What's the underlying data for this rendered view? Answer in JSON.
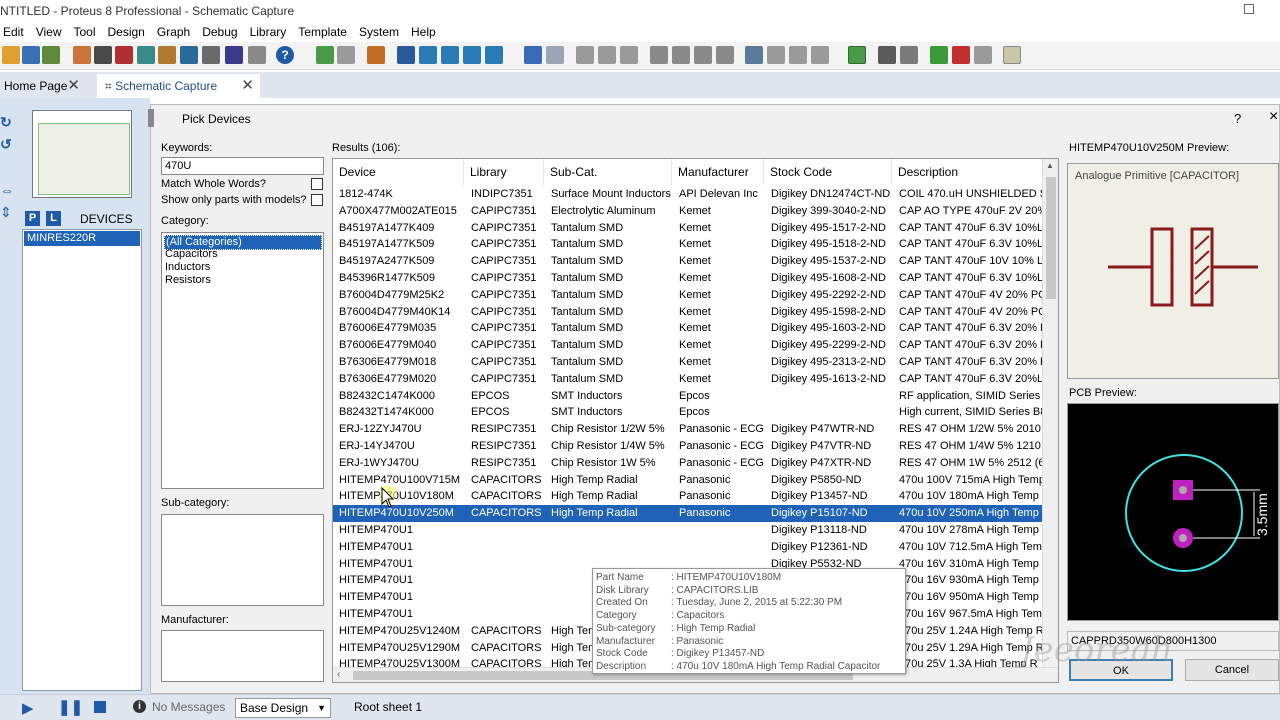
{
  "window": {
    "title": "NTITLED - Proteus 8 Professional - Schematic Capture"
  },
  "menu": [
    "Edit",
    "View",
    "Tool",
    "Design",
    "Graph",
    "Debug",
    "Library",
    "Template",
    "System",
    "Help"
  ],
  "tabs": [
    {
      "label": "Home Page"
    },
    {
      "label": "Schematic Capture"
    }
  ],
  "left_panel": {
    "mode_p": "P",
    "mode_l": "L",
    "devices_label": "DEVICES",
    "devices": [
      "MINRES220R"
    ]
  },
  "dialog": {
    "title": "Pick Devices",
    "help": "?",
    "close": "×",
    "keywords_label": "Keywords:",
    "keywords_value": "470U",
    "match_whole_words": "Match Whole Words?",
    "show_only_models": "Show only parts with models?",
    "category_label": "Category:",
    "categories": [
      "(All Categories)",
      "Capacitors",
      "Inductors",
      "Resistors"
    ],
    "subcategory_label": "Sub-category:",
    "manufacturer_label": "Manufacturer:",
    "results_label": "Results (106):",
    "columns": [
      "Device",
      "Library",
      "Sub-Cat.",
      "Manufacturer",
      "Stock Code",
      "Description"
    ],
    "rows": [
      [
        "1812-474K",
        "INDIPC7351",
        "Surface Mount Inductors",
        "API Delevan Inc",
        "Digikey DN12474CT-ND",
        "COIL 470.uH UNSHIELDED S"
      ],
      [
        "A700X477M002ATE015",
        "CAPIPC7351",
        "Electrolytic Aluminum",
        "Kemet",
        "Digikey 399-3040-2-ND",
        "CAP AO TYPE 470uF 2V 20%"
      ],
      [
        "B45197A1477K409",
        "CAPIPC7351",
        "Tantalum SMD",
        "Kemet",
        "Digikey 495-1517-2-ND",
        "CAP TANT 470uF 6.3V 10%LO"
      ],
      [
        "B45197A1477K509",
        "CAPIPC7351",
        "Tantalum SMD",
        "Kemet",
        "Digikey 495-1518-2-ND",
        "CAP TANT 470uF 6.3V 10%LO"
      ],
      [
        "B45197A2477K509",
        "CAPIPC7351",
        "Tantalum SMD",
        "Kemet",
        "Digikey 495-1537-2-ND",
        "CAP TANT 470uF 10V 10% LO"
      ],
      [
        "B45396R1477K509",
        "CAPIPC7351",
        "Tantalum SMD",
        "Kemet",
        "Digikey 495-1608-2-ND",
        "CAP TANT 470uF 6.3V 10%LO"
      ],
      [
        "B76004D4779M25K2",
        "CAPIPC7351",
        "Tantalum SMD",
        "Kemet",
        "Digikey 495-2292-2-ND",
        "CAP TANT 470uF 4V 20% PO"
      ],
      [
        "B76004D4779M40K14",
        "CAPIPC7351",
        "Tantalum SMD",
        "Kemet",
        "Digikey 495-1598-2-ND",
        "CAP TANT 470uF 4V 20% PO"
      ],
      [
        "B76006E4779M035",
        "CAPIPC7351",
        "Tantalum SMD",
        "Kemet",
        "Digikey 495-1603-2-ND",
        "CAP TANT 470uF 6.3V 20% P"
      ],
      [
        "B76006E4779M040",
        "CAPIPC7351",
        "Tantalum SMD",
        "Kemet",
        "Digikey 495-2299-2-ND",
        "CAP TANT 470uF 6.3V 20% P"
      ],
      [
        "B76306E4779M018",
        "CAPIPC7351",
        "Tantalum SMD",
        "Kemet",
        "Digikey 495-2313-2-ND",
        "CAP TANT 470uF 6.3V 20% P"
      ],
      [
        "B76306E4779M020",
        "CAPIPC7351",
        "Tantalum SMD",
        "Kemet",
        "Digikey 495-1613-2-ND",
        "CAP TANT 470uF 6.3V 20%LO"
      ],
      [
        "B82432C1474K000",
        "EPCOS",
        "SMT Inductors",
        "Epcos",
        "",
        "RF application, SIMID Series E"
      ],
      [
        "B82432T1474K000",
        "EPCOS",
        "SMT Inductors",
        "Epcos",
        "",
        "High current, SIMID Series B8"
      ],
      [
        "ERJ-12ZYJ470U",
        "RESIPC7351",
        "Chip Resistor 1/2W 5%",
        "Panasonic - ECG",
        "Digikey P47WTR-ND",
        "RES 47 OHM 1/2W 5% 2010"
      ],
      [
        "ERJ-14YJ470U",
        "RESIPC7351",
        "Chip Resistor 1/4W 5%",
        "Panasonic - ECG",
        "Digikey P47VTR-ND",
        "RES 47 OHM 1/4W 5% 1210"
      ],
      [
        "ERJ-1WYJ470U",
        "RESIPC7351",
        "Chip Resistor 1W 5%",
        "Panasonic - ECG",
        "Digikey P47XTR-ND",
        "RES 47 OHM 1W 5% 2512 (64"
      ],
      [
        "HITEMP470U100V715M",
        "CAPACITORS",
        "High Temp Radial",
        "Panasonic",
        "Digikey P5850-ND",
        "470u 100V 715mA High Temp"
      ],
      [
        "HITEMP470U10V180M",
        "CAPACITORS",
        "High Temp Radial",
        "Panasonic",
        "Digikey P13457-ND",
        "470u 10V 180mA High Temp F"
      ],
      [
        "HITEMP470U10V250M",
        "CAPACITORS",
        "High Temp Radial",
        "Panasonic",
        "Digikey P15107-ND",
        "470u 10V 250mA High Temp F"
      ],
      [
        "HITEMP470U1",
        "",
        "",
        "",
        "Digikey P13118-ND",
        "470u 10V 278mA High Temp F"
      ],
      [
        "HITEMP470U1",
        "",
        "",
        "",
        "Digikey P12361-ND",
        "470u 10V 712.5mA High Temp"
      ],
      [
        "HITEMP470U1",
        "",
        "",
        "",
        "Digikey P5532-ND",
        "470u 16V 310mA High Temp F"
      ],
      [
        "HITEMP470U1",
        "",
        "",
        "",
        "Digikey P12376-ND",
        "470u 16V 930mA High Temp F"
      ],
      [
        "HITEMP470U1",
        "",
        "",
        "",
        "Digikey P14394-ND",
        "470u 16V 950mA High Temp F"
      ],
      [
        "HITEMP470U1",
        "",
        "",
        "",
        "Digikey P12375-ND",
        "470u 16V 967.5mA High Temp"
      ],
      [
        "HITEMP470U25V1240M",
        "CAPACITORS",
        "High Temp Radial",
        "Panasonic",
        "Digikey P14417-ND",
        "470u 25V 1.24A High Temp R"
      ],
      [
        "HITEMP470U25V1290M",
        "CAPACITORS",
        "High Temp Radial",
        "Panasonic",
        "Digikey P14419-ND",
        "470u 25V 1.29A High Temp R"
      ],
      [
        "HITEMP470U25V1300M",
        "CAPACITORS",
        "High Temp Radial",
        "Panasonic",
        "Digikey P12388-ND",
        "470u 25V 1.3A High Temp R"
      ]
    ],
    "tooltip": [
      [
        "Part Name",
        ": HITEMP470U10V180M"
      ],
      [
        "Disk Library",
        ": CAPACITORS.LIB"
      ],
      [
        "Created On",
        ": Tuesday, June 2, 2015 at 5:22:30 PM"
      ],
      [
        "Category",
        ": Capacitors"
      ],
      [
        "Sub-category",
        ": High Temp Radial"
      ],
      [
        "Manufacturer",
        ": Panasonic"
      ],
      [
        "Stock Code",
        ": Digikey P13457-ND"
      ],
      [
        "Description",
        ": 470u 10V 180mA High Temp Radial Capacitor"
      ]
    ],
    "preview_label": "HITEMP470U10V250M Preview:",
    "preview_text": "Analogue Primitive [CAPACITOR]",
    "pcb_label": "PCB Preview:",
    "pcb_dim": "3.5mm",
    "package": "CAPPRD350W60D800H1300",
    "ok": "OK",
    "cancel": "Cancel"
  },
  "status": {
    "messages": "No Messages",
    "design": "Base Design",
    "sheet": "Root sheet 1"
  },
  "watermark": "Jeeoreah"
}
